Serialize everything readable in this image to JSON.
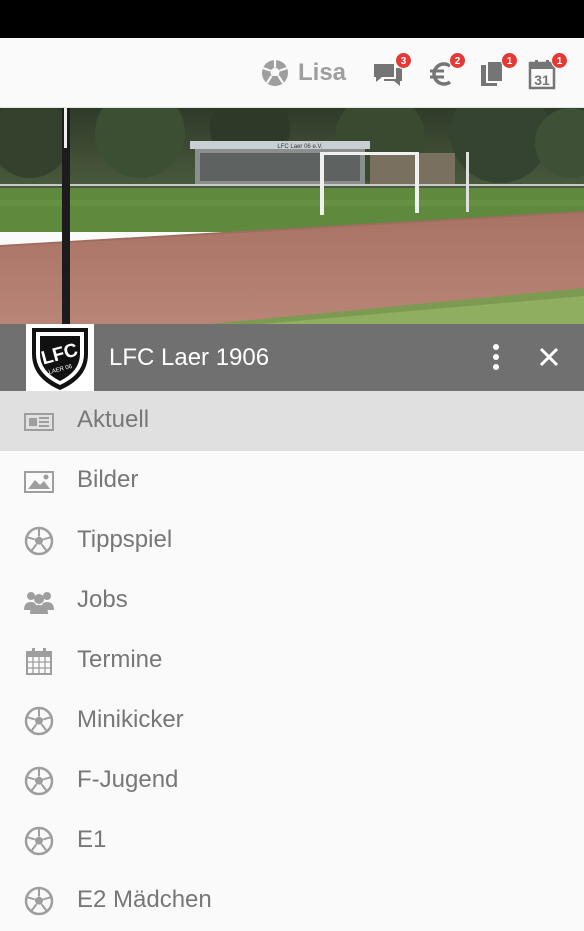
{
  "app_bar": {
    "user_name": "Lisa",
    "actions": [
      {
        "icon": "chat-icon",
        "badge": "3"
      },
      {
        "icon": "euro-icon",
        "badge": "2"
      },
      {
        "icon": "documents-icon",
        "badge": "1"
      },
      {
        "icon": "calendar-icon",
        "badge": "1",
        "day": "31"
      }
    ],
    "badge_color": "#e53935"
  },
  "header": {
    "logo_text": "LFC",
    "logo_subtext": "LAER 06",
    "stand_sign": "LFC Laer 06 e.V.",
    "club_name": "LFC Laer 1906",
    "bar_color": "#707070"
  },
  "menu": {
    "items": [
      {
        "label": "Aktuell",
        "icon": "newspaper-icon",
        "active": true
      },
      {
        "label": "Bilder",
        "icon": "image-icon"
      },
      {
        "label": "Tippspiel",
        "icon": "soccer-ball-icon"
      },
      {
        "label": "Jobs",
        "icon": "group-icon"
      },
      {
        "label": "Termine",
        "icon": "calendar-grid-icon"
      },
      {
        "label": "Minikicker",
        "icon": "soccer-ball-icon"
      },
      {
        "label": "F-Jugend",
        "icon": "soccer-ball-icon"
      },
      {
        "label": "E1",
        "icon": "soccer-ball-icon"
      },
      {
        "label": "E2 Mädchen",
        "icon": "soccer-ball-icon"
      }
    ]
  }
}
